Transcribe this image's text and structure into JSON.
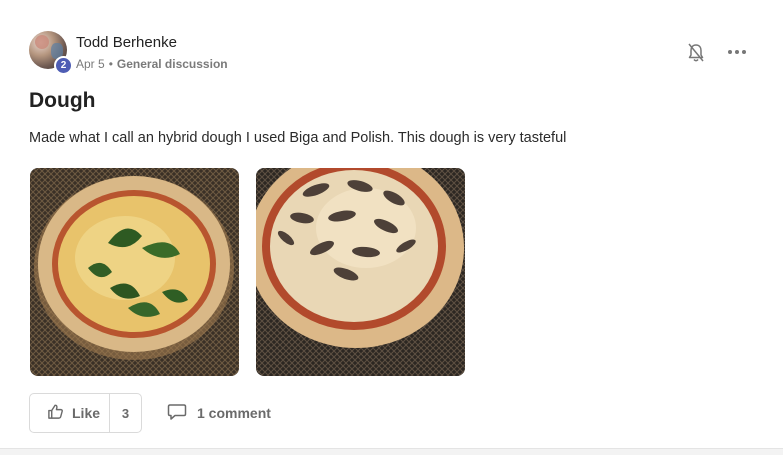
{
  "post": {
    "author": "Todd Berhenke",
    "level": "2",
    "date": "Apr 5",
    "separator": "•",
    "category": "General discussion",
    "title": "Dough",
    "body": "Made what I call an hybrid dough I used Biga and Polish. This dough is very tasteful",
    "images": [
      {
        "description": "pizza-with-basil"
      },
      {
        "description": "pizza-with-mushrooms"
      }
    ]
  },
  "actions": {
    "like_label": "Like",
    "like_count": "3",
    "comment_label": "1 comment"
  },
  "icons": {
    "bell": "bell-muted-icon",
    "more": "more-horizontal-icon",
    "like": "thumbs-up-icon",
    "comment": "comment-icon"
  },
  "colors": {
    "badge": "#4e5db4",
    "muted_text": "#7a7a7a"
  }
}
